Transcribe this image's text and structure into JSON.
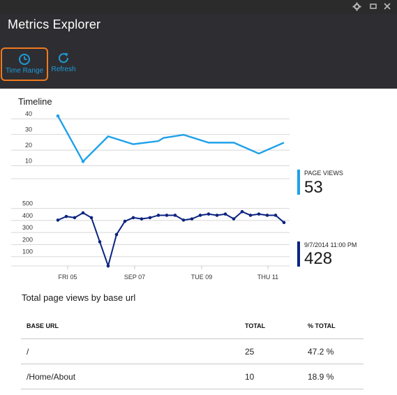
{
  "window": {
    "controls": [
      "gear-icon",
      "restore-icon",
      "close-icon"
    ]
  },
  "header": {
    "title": "Metrics Explorer",
    "commands": {
      "time_range": {
        "label": "Time Range",
        "icon": "clock-icon"
      },
      "refresh": {
        "label": "Refresh",
        "icon": "refresh-icon"
      }
    },
    "accent": "#1e9bd8",
    "highlight": "#f07a1e"
  },
  "timeline": {
    "title": "Timeline",
    "x_ticks": [
      "FRI 05",
      "SEP 07",
      "TUE 09",
      "THU 11"
    ]
  },
  "chart_data": [
    {
      "type": "line",
      "series": [
        {
          "name": "PAGE VIEWS",
          "color": "#1ea1e9",
          "x": [
            0,
            1,
            2,
            2.2,
            3,
            4,
            4.2,
            5,
            6,
            7,
            8,
            9
          ],
          "values": [
            40,
            11,
            27,
            26,
            22,
            24,
            26,
            28,
            23,
            23,
            16,
            23
          ]
        }
      ],
      "yticks": [
        10,
        20,
        30,
        40
      ],
      "ylim": [
        0,
        45
      ]
    },
    {
      "type": "line",
      "series": [
        {
          "name": "",
          "color": "#0c2480",
          "values": [
            380,
            410,
            400,
            440,
            400,
            200,
            0,
            260,
            370,
            400,
            390,
            400,
            420,
            420,
            420,
            380,
            390,
            420,
            430,
            420,
            430,
            390,
            450,
            420,
            430,
            420,
            420,
            360
          ]
        }
      ],
      "yticks": [
        100,
        200,
        300,
        400,
        500
      ],
      "ylim": [
        0,
        550
      ]
    }
  ],
  "legend": {
    "page_views": {
      "label": "PAGE VIEWS",
      "value": "53",
      "color": "#1ea1e9"
    },
    "requests": {
      "label": "9/7/2014 11:00 PM",
      "value": "428",
      "color": "#0c2480"
    }
  },
  "table": {
    "title": "Total page views by base url",
    "headers": [
      "BASE URL",
      "TOTAL",
      "% TOTAL"
    ],
    "rows": [
      [
        "/",
        "25",
        "47.2 %"
      ],
      [
        "/Home/About",
        "10",
        "18.9 %"
      ]
    ]
  }
}
